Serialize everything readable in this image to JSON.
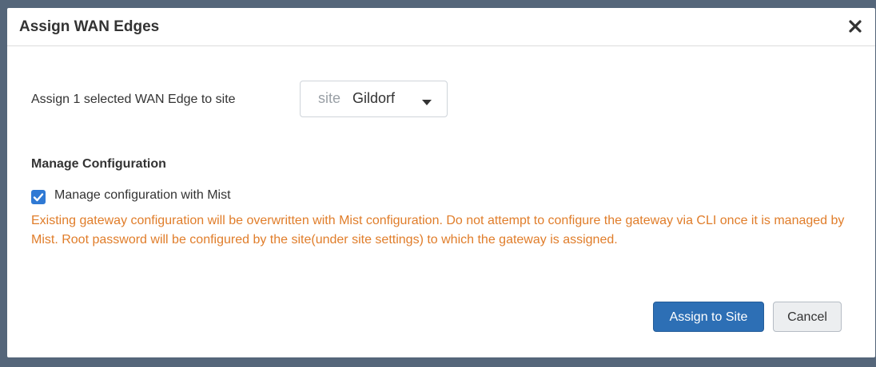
{
  "modal": {
    "title": "Assign WAN Edges",
    "close_icon": "close-icon"
  },
  "assign": {
    "label": "Assign 1 selected WAN Edge to site",
    "site_prefix": "site",
    "site_value": "Gildorf",
    "caret_icon": "caret-down-icon"
  },
  "manage_config": {
    "heading": "Manage Configuration",
    "checkbox_checked": true,
    "checkbox_label": "Manage configuration with Mist",
    "warning": "Existing gateway configuration will be overwritten with Mist configuration. Do not attempt to configure the gateway via CLI once it is managed by Mist. Root password will be configured by the site(under site settings) to which the gateway is assigned."
  },
  "buttons": {
    "assign_label": "Assign to Site",
    "cancel_label": "Cancel"
  },
  "colors": {
    "primary": "#2d6fb5",
    "warning": "#e07d2a",
    "checkbox": "#2f79d4"
  }
}
